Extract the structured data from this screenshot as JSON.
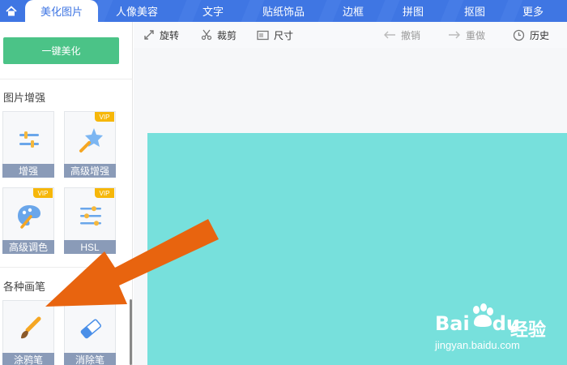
{
  "nav": {
    "tabs": [
      {
        "label": "美化图片",
        "active": true
      },
      {
        "label": "人像美容"
      },
      {
        "label": "文字"
      },
      {
        "label": "贴纸饰品"
      },
      {
        "label": "边框"
      },
      {
        "label": "拼图"
      },
      {
        "label": "抠图"
      },
      {
        "label": "更多"
      }
    ]
  },
  "sidebar": {
    "one_click": "一键美化",
    "section_enhance": "图片增强",
    "tiles_enhance": [
      {
        "label": "增强",
        "icon": "sliders-icon",
        "vip": ""
      },
      {
        "label": "高级增强",
        "icon": "star-wand-icon",
        "vip": "VIP"
      },
      {
        "label": "高级调色",
        "icon": "palette-icon",
        "vip": "VIP"
      },
      {
        "label": "HSL",
        "icon": "hsl-sliders-icon",
        "vip": "VIP"
      }
    ],
    "section_brush": "各种画笔",
    "tiles_brush": [
      {
        "label": "涂鸦笔",
        "icon": "brush-icon"
      },
      {
        "label": "消除笔",
        "icon": "eraser-icon"
      }
    ]
  },
  "toolbar": {
    "rotate": "旋转",
    "crop": "裁剪",
    "size": "尺寸",
    "undo": "撤销",
    "redo": "重做",
    "history": "历史"
  },
  "watermark": {
    "brand": "Bai",
    "brand_suffix": "du",
    "jingyan": "经验",
    "url": "jingyan.baidu.com"
  },
  "colors": {
    "nav_blue": "#3f76e3",
    "green": "#4bc387",
    "canvas": "#77e0dc",
    "arrow": "#e8640f",
    "vip": "#f6b70a"
  }
}
